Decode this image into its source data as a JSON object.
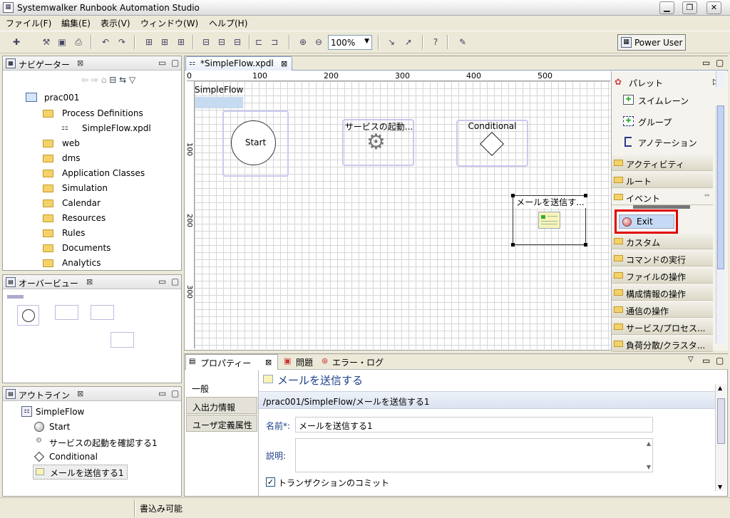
{
  "window": {
    "title": "Systemwalker Runbook Automation Studio",
    "buttons": [
      "▁",
      "❐",
      "✕"
    ]
  },
  "menu": [
    "ファイル(F)",
    "編集(E)",
    "表示(V)",
    "ウィンドウ(W)",
    "ヘルプ(H)"
  ],
  "toolbar": {
    "zoom": "100%",
    "perspective": "Power User"
  },
  "navigator": {
    "title": "ナビゲーター",
    "project": "prac001",
    "items": [
      {
        "label": "Process Definitions",
        "type": "folder"
      },
      {
        "label": "SimpleFlow.xpdl",
        "type": "file"
      },
      {
        "label": "web",
        "type": "folder"
      },
      {
        "label": "dms",
        "type": "folder"
      },
      {
        "label": "Application Classes",
        "type": "folder"
      },
      {
        "label": "Simulation",
        "type": "folder"
      },
      {
        "label": "Calendar",
        "type": "folder"
      },
      {
        "label": "Resources",
        "type": "folder"
      },
      {
        "label": "Rules",
        "type": "folder"
      },
      {
        "label": "Documents",
        "type": "folder"
      },
      {
        "label": "Analytics",
        "type": "folder"
      }
    ]
  },
  "overview": {
    "title": "オーバービュー"
  },
  "outline": {
    "title": "アウトライン",
    "root": "SimpleFlow",
    "items": [
      "Start",
      "サービスの起動を確認する1",
      "Conditional",
      "メールを送信する1"
    ]
  },
  "editor": {
    "tab": "*SimpleFlow.xpdl",
    "ruler_h": [
      "0",
      "100",
      "200",
      "300",
      "400",
      "500"
    ],
    "ruler_v": [
      "100",
      "200",
      "300"
    ],
    "pool": "SimpleFlow",
    "nodes": {
      "start": "Start",
      "service": "サービスの起動...",
      "conditional": "Conditional",
      "mail": "メールを送信す..."
    }
  },
  "palette": {
    "title": "パレット",
    "tools": [
      "スイムレーン",
      "グループ",
      "アノテーション"
    ],
    "drawers_top": [
      "アクティビティ",
      "ルート",
      "イベント"
    ],
    "highlight": "Exit",
    "drawers": [
      "カスタム",
      "コマンドの実行",
      "ファイルの操作",
      "構成情報の操作",
      "通信の操作",
      "サービス/プロセス...",
      "負荷分散/クラスタ..."
    ]
  },
  "bottom_tabs": [
    "プロパティー",
    "問題",
    "エラー・ログ"
  ],
  "properties": {
    "heading": "メールを送信する",
    "path": "/prac001/SimpleFlow/メールを送信する1",
    "side_tabs": [
      "一般",
      "入出力情報",
      "ユーザ定義属性"
    ],
    "name_label": "名前*:",
    "name_value": "メールを送信する1",
    "desc_label": "説明:",
    "commit_label": "トランザクションのコミット"
  },
  "status": "書込み可能",
  "colors": {
    "highlight_border": "#e00000",
    "node_border": "#c9c9ef",
    "tab_active": "#4a80c8"
  }
}
